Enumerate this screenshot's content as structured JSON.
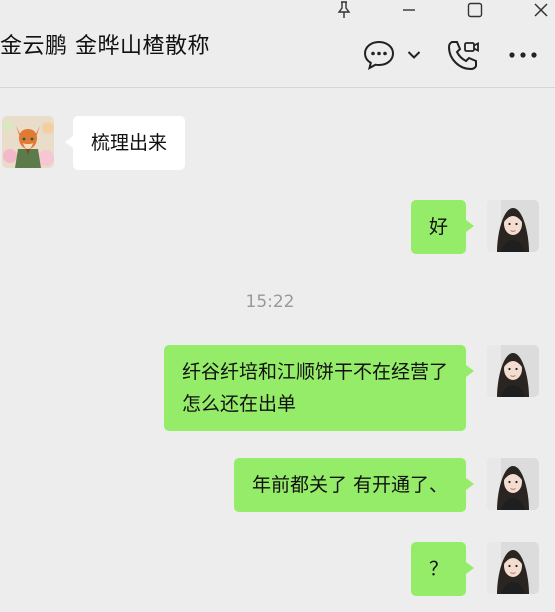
{
  "window": {
    "controls": [
      "pin-icon",
      "minimize-icon",
      "maximize-icon",
      "close-icon"
    ]
  },
  "header": {
    "title": "金云鹏 金晔山楂散称",
    "icons": [
      "chat-bubble-icon",
      "chevron-down-icon",
      "video-call-icon",
      "more-icon"
    ]
  },
  "colors": {
    "background": "#ededed",
    "sent_bubble": "#95ec69",
    "received_bubble": "#ffffff",
    "timestamp": "#999999"
  },
  "messages": [
    {
      "side": "left",
      "text": "梳理出来"
    },
    {
      "side": "right",
      "text": "好"
    },
    {
      "type": "time",
      "text": "15:22"
    },
    {
      "side": "right",
      "lines": [
        "纤谷纤培和江顺饼干不在经营了",
        "怎么还在出单"
      ]
    },
    {
      "side": "right",
      "text": "年前都关了 有开通了、"
    },
    {
      "side": "right",
      "text": "？"
    }
  ]
}
